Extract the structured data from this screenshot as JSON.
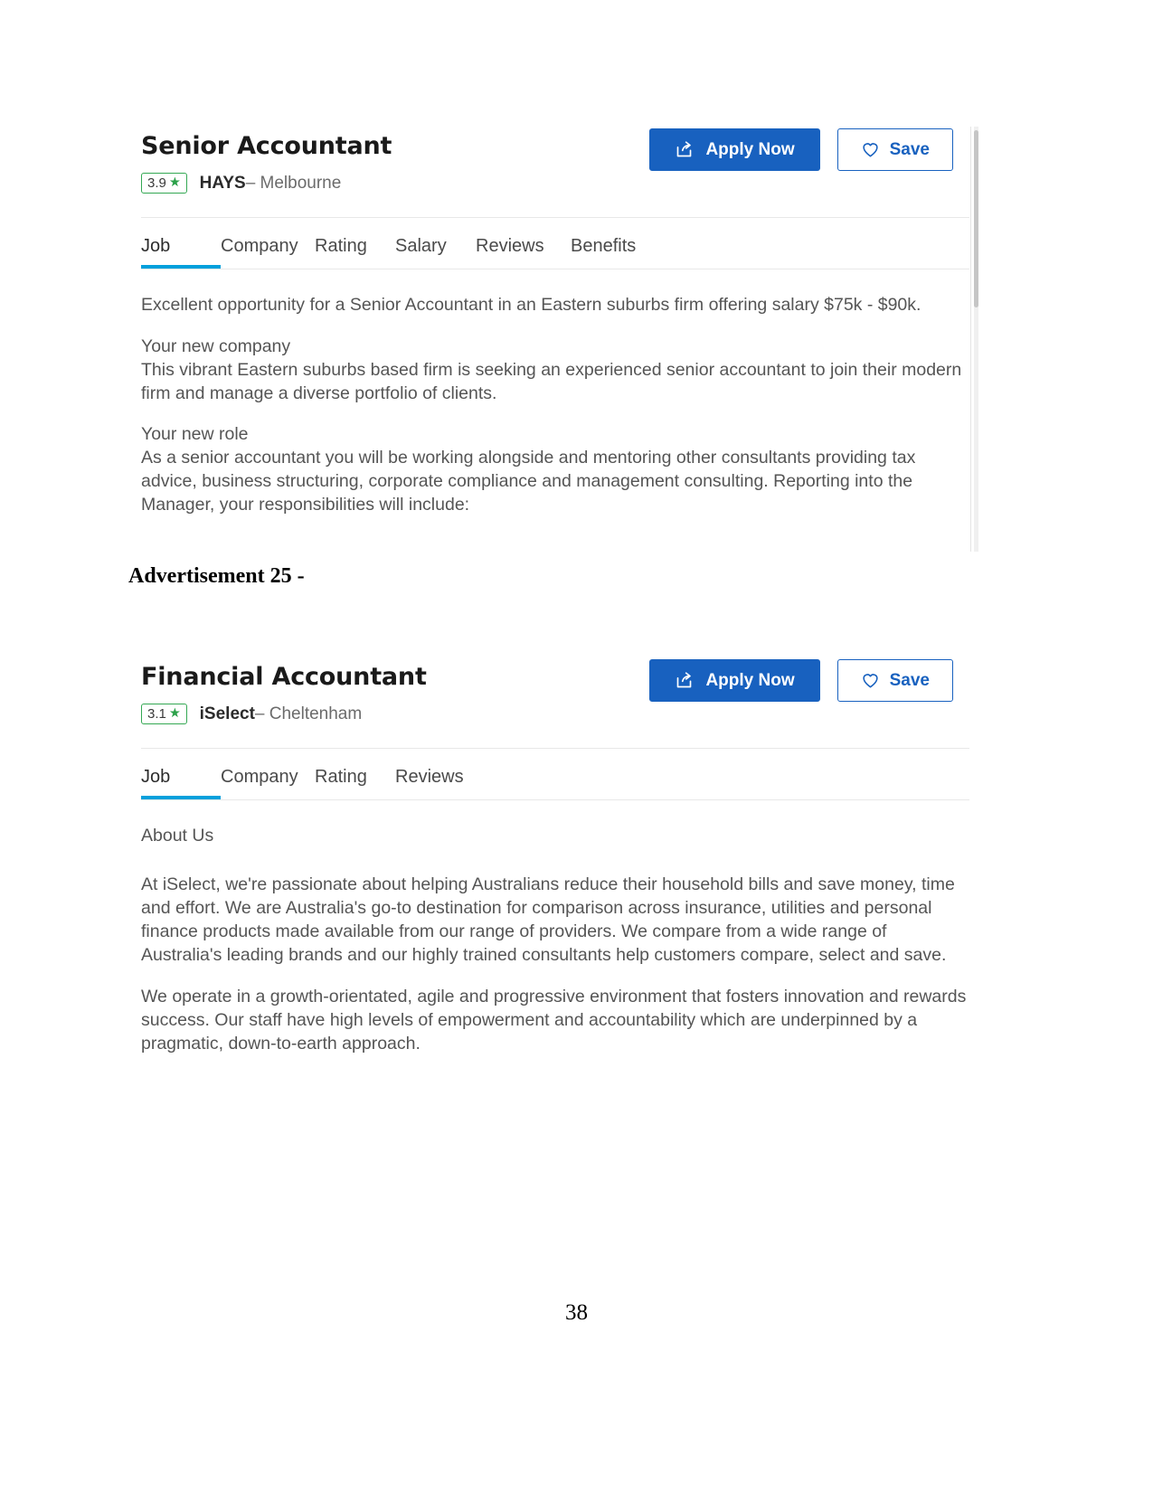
{
  "document": {
    "page_number": "38",
    "advertisement_caption": "Advertisement 25 -"
  },
  "listings": [
    {
      "job_title": "Senior Accountant",
      "rating": "3.9",
      "star_glyph": "★",
      "employer": "HAYS",
      "location": "– Melbourne",
      "apply_button": "Apply Now",
      "save_button": "Save",
      "apply_icon": "share-export-icon",
      "save_icon": "heart-outline-icon",
      "tabs": [
        {
          "label": "Job",
          "active": true
        },
        {
          "label": "Company",
          "active": false
        },
        {
          "label": "Rating",
          "active": false
        },
        {
          "label": "Salary",
          "active": false
        },
        {
          "label": "Reviews",
          "active": false
        },
        {
          "label": "Benefits",
          "active": false
        }
      ],
      "body": {
        "intro": "Excellent opportunity for a Senior Accountant in an Eastern suburbs firm offering salary $75k - $90k.",
        "heading_1": "Your new company",
        "para_1": "This vibrant Eastern suburbs based firm is seeking an experienced senior accountant to join their modern firm and manage a diverse portfolio of clients.",
        "heading_2": "Your new role",
        "para_2": "As a senior accountant you will be working alongside and mentoring other consultants providing tax advice, business structuring, corporate compliance and management consulting. Reporting into the Manager, your responsibilities will include:"
      }
    },
    {
      "job_title": "Financial Accountant",
      "rating": "3.1",
      "star_glyph": "★",
      "employer": "iSelect",
      "location": "– Cheltenham",
      "apply_button": "Apply Now",
      "save_button": "Save",
      "apply_icon": "share-export-icon",
      "save_icon": "heart-outline-icon",
      "tabs": [
        {
          "label": "Job",
          "active": true
        },
        {
          "label": "Company",
          "active": false
        },
        {
          "label": "Rating",
          "active": false
        },
        {
          "label": "Reviews",
          "active": false
        }
      ],
      "body": {
        "heading_1": "About Us",
        "para_1": "At iSelect, we're passionate about helping Australians reduce their household bills and save money, time and effort. We are Australia's go-to destination for comparison across insurance, utilities and personal finance products made available from our range of providers. We compare from a wide range of Australia's leading brands and our highly trained consultants help customers compare, select and save.",
        "para_2": "We operate in a growth-orientated, agile and progressive environment that fosters innovation and rewards success. Our staff have high levels of empowerment and accountability which are underpinned by a pragmatic, down-to-earth approach."
      }
    }
  ],
  "colors": {
    "primary_blue": "#1861bf",
    "tab_active": "#00a0dc",
    "rating_green": "#34a853",
    "body_text": "#555555"
  }
}
